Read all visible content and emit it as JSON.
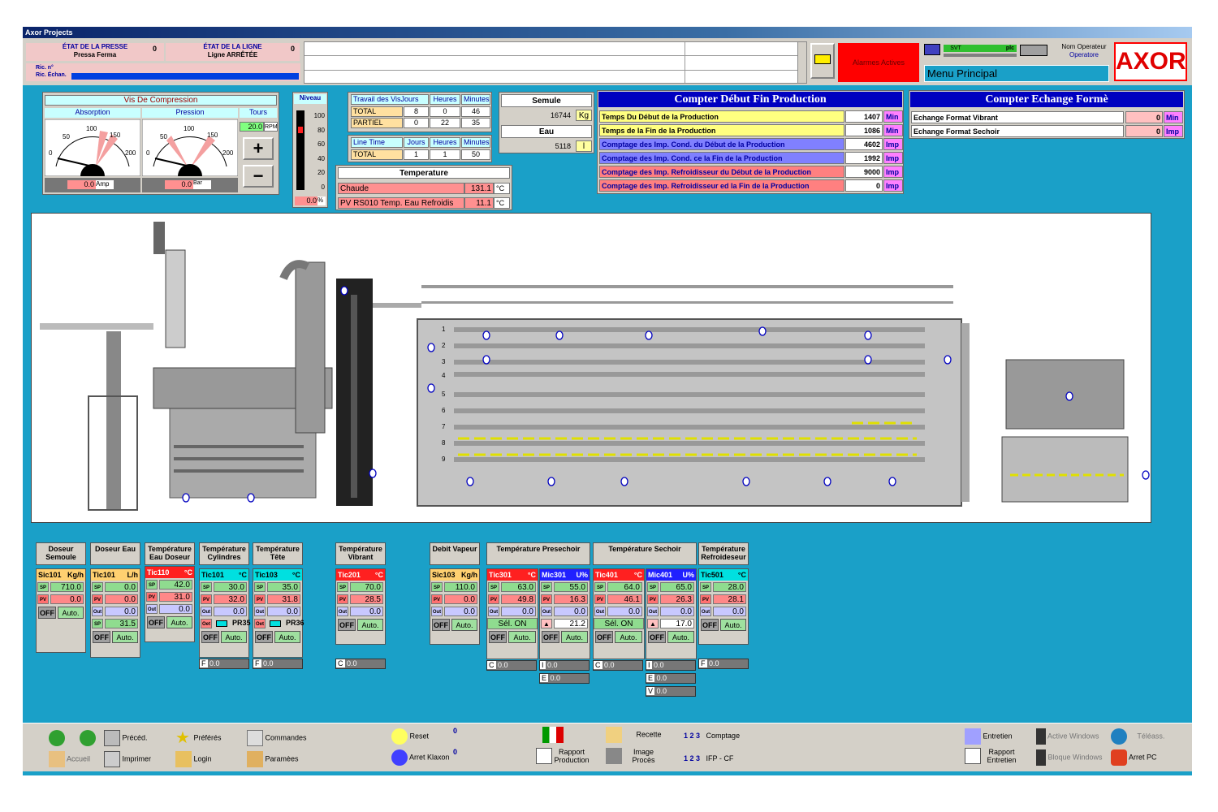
{
  "window": {
    "title": "Axor Projects"
  },
  "header": {
    "press_state_label": "ÉTAT DE LA PRESSE",
    "press_state_count": "0",
    "press_state_value": "Pressa Ferma",
    "line_state_label": "ÉTAT DE LA LIGNE",
    "line_state_count": "0",
    "line_state_value": "Ligne ARRÊTÉE",
    "ric_label": "Ric. n°",
    "ric_echan_label": "Ric. Échan.",
    "alarm_label": "Alarmes Actives",
    "svt_label": "SVT",
    "plc_label": "plc",
    "operator_label": "Nom Operateur",
    "operator_value": "Operatore",
    "menu_label": "Menu Principal",
    "logo": "AXOR"
  },
  "vis": {
    "title": "Vis De Compression",
    "absorption": "Absorption",
    "pression": "Pression",
    "tours": "Tours",
    "rpm_value": "20.0",
    "rpm_unit": "RPM",
    "amp_value": "0.0",
    "amp_unit": "Amp",
    "bar_value": "0.0",
    "bar_unit": "Bar",
    "plus": "+",
    "minus": "−",
    "ticks": [
      "0",
      "50",
      "100",
      "150",
      "200"
    ]
  },
  "niveau": {
    "title": "Niveau",
    "ticks": [
      "100",
      "80",
      "60",
      "40",
      "20",
      "0"
    ],
    "value": "0.0",
    "unit": "%"
  },
  "work": {
    "h1": "Travail des VisJours",
    "h2": "Heures",
    "h3": "Minutes",
    "total_label": "TOTAL",
    "total": [
      "8",
      "0",
      "46"
    ],
    "partiel_label": "PARTIEL",
    "partiel": [
      "0",
      "22",
      "35"
    ],
    "line_h1": "Line Time",
    "line_h2": "Jours",
    "line_h3": "Heures",
    "line_h4": "Minutes",
    "line_total_label": "TOTAL",
    "line_total": [
      "1",
      "1",
      "50"
    ]
  },
  "semule": {
    "title": "Semule",
    "value": "16744",
    "unit": "Kg",
    "eau_title": "Eau",
    "eau_value": "5118",
    "eau_unit": "l"
  },
  "temperature": {
    "title": "Temperature",
    "rows": [
      {
        "label": "Chaude",
        "value": "131.1",
        "unit": "°C"
      },
      {
        "label": "PV RS010 Temp. Eau  Refroidis",
        "value": "11.1",
        "unit": "°C"
      }
    ]
  },
  "production": {
    "title": "Compter Début Fin Production",
    "rows": [
      {
        "label": "Temps Du Début de la Production",
        "value": "1407",
        "unit": "Min",
        "color": "#ffff80"
      },
      {
        "label": "Temps de la Fin de la Production",
        "value": "1086",
        "unit": "Min",
        "color": "#ffff80"
      },
      {
        "label": "Comptage des Imp. Cond. du Début de la Production",
        "value": "4602",
        "unit": "Imp",
        "color": "#8080ff"
      },
      {
        "label": "Comptage des Imp. Cond. ce la Fin de la Production",
        "value": "1992",
        "unit": "Imp",
        "color": "#8080ff"
      },
      {
        "label": "Comptage des Imp. Refroidisseur du Début de la Production",
        "value": "9000",
        "unit": "Imp",
        "color": "#ff8080"
      },
      {
        "label": "Comptage des Imp. Refroidisseur ed la Fin de la Production",
        "value": "0",
        "unit": "Imp",
        "color": "#ff8080"
      }
    ]
  },
  "echange": {
    "title": "Compter Echange Formè",
    "rows": [
      {
        "label": "Echange Format Vibrant",
        "value": "0",
        "unit": "Min"
      },
      {
        "label": "Echange Format Sechoir",
        "value": "0",
        "unit": "Imp"
      }
    ]
  },
  "dryer_levels": [
    "1",
    "2",
    "3",
    "4",
    "5",
    "6",
    "7",
    "8",
    "9"
  ],
  "controls": {
    "off": "OFF",
    "auto": "Auto.",
    "sp": "SP",
    "pv": "PV",
    "out": "Out",
    "oet": "Oet",
    "sel_on": "Sél. ON"
  },
  "units": [
    {
      "id": "doseur-semoule",
      "title": "Doseur Semoule",
      "tag": "Sic101",
      "unit": "Kg/h",
      "tagcolor": "#ffd070",
      "sp": "710.0",
      "pv": "0.0"
    },
    {
      "id": "doseur-eau",
      "title": "Doseur Eau",
      "tag": "Tic101",
      "unit": "L/h",
      "tagcolor": "#ffd070",
      "sp": "0.0",
      "pv": "0.0",
      "out": "0.0",
      "sp2": "31.5"
    },
    {
      "id": "temp-eau-doseur",
      "title": "Température Eau Doseur",
      "tag": "Tic110",
      "unit": "°C",
      "tagcolor": "#ff2020",
      "sp": "42.0",
      "pv": "31.0",
      "out": "0.0"
    },
    {
      "id": "temp-cylindres",
      "title": "Température Cylindres",
      "tag": "Tic101",
      "unit": "°C",
      "tagcolor": "#00e0e0",
      "sp": "30.0",
      "pv": "32.0",
      "out": "0.0",
      "extra": "PR35",
      "f": "F",
      "fval": "0.0"
    },
    {
      "id": "temp-tete",
      "title": "Température Tête",
      "tag": "Tic103",
      "unit": "°C",
      "tagcolor": "#00e0e0",
      "sp": "35.0",
      "pv": "31.8",
      "out": "0.0",
      "extra": "PR36",
      "f": "F",
      "fval": "0.0"
    },
    {
      "id": "temp-vibrant",
      "title": "Température Vibrant",
      "tag": "Tic201",
      "unit": "°C",
      "tagcolor": "#ff2020",
      "sp": "70.0",
      "pv": "28.5",
      "out": "0.0",
      "f": "C",
      "fval": "0.0"
    },
    {
      "id": "debit-vapeur",
      "title": "Debit Vapeur",
      "tag": "Sic103",
      "unit": "Kg/h",
      "tagcolor": "#ffd070",
      "sp": "110.0",
      "pv": "0.0",
      "out": "0.0"
    },
    {
      "id": "temp-presechoir",
      "title": "Température Presechoir",
      "a": {
        "tag": "Tic301",
        "unit": "°C",
        "tagcolor": "#ff2020",
        "sp": "63.0",
        "pv": "49.8",
        "out": "0.0",
        "sel": "Sél. ON",
        "f": "C",
        "fval": "0.0"
      },
      "b": {
        "tag": "Mic301",
        "unit": "U%",
        "tagcolor": "#2020ff",
        "sp": "55.0",
        "pv": "16.3",
        "out": "0.0",
        "delta": "21.2",
        "i": "I",
        "ival": "0.0",
        "e": "E",
        "eval": "0.0"
      }
    },
    {
      "id": "temp-sechoir",
      "title": "Température Sechoir",
      "a": {
        "tag": "Tic401",
        "unit": "°C",
        "tagcolor": "#ff2020",
        "sp": "64.0",
        "pv": "46.1",
        "out": "0.0",
        "sel": "Sél. ON",
        "f": "C",
        "fval": "0.0"
      },
      "b": {
        "tag": "Mic401",
        "unit": "U%",
        "tagcolor": "#2020ff",
        "sp": "65.0",
        "pv": "26.3",
        "out": "0.0",
        "delta": "17.0",
        "i": "I",
        "ival": "0.0",
        "e": "E",
        "eval": "0.0",
        "v": "V",
        "vval": "0.0"
      }
    },
    {
      "id": "temp-refroideseur",
      "title": "Température Refroideseur",
      "tag": "Tic501",
      "unit": "°C",
      "tagcolor": "#00e0e0",
      "sp": "28.0",
      "pv": "28.1",
      "out": "0.0",
      "f": "F",
      "fval": "0.0"
    }
  ],
  "footer": {
    "preced": "Précéd.",
    "accueil": "Accueil",
    "imprimer": "Imprimer",
    "preferes": "Préférés",
    "login": "Login",
    "commandes": "Commandes",
    "parametres": "Paramèes",
    "reset": "Reset",
    "reset_count": "0",
    "klaxon": "Arret Klaxon",
    "klaxon_count": "0",
    "rapport_prod_1": "Rapport",
    "rapport_prod_2": "Production",
    "recette": "Recette",
    "image_1": "Image",
    "image_2": "Procès",
    "comptage_num": "1 2 3",
    "comptage": "Comptage",
    "ifp_num": "1 2 3",
    "ifp": "IFP - CF",
    "entretien": "Entretien",
    "rapport_ent_1": "Rapport",
    "rapport_ent_2": "Entretien",
    "active_windows": "Active Windows",
    "bloque_windows": "Bloque Windows",
    "teleass": "Téléass.",
    "arret_pc": "Arret PC"
  },
  "colors": {
    "background": "#1aa0c8",
    "alarm": "#ff0000",
    "header_blue": "#0000c0"
  }
}
